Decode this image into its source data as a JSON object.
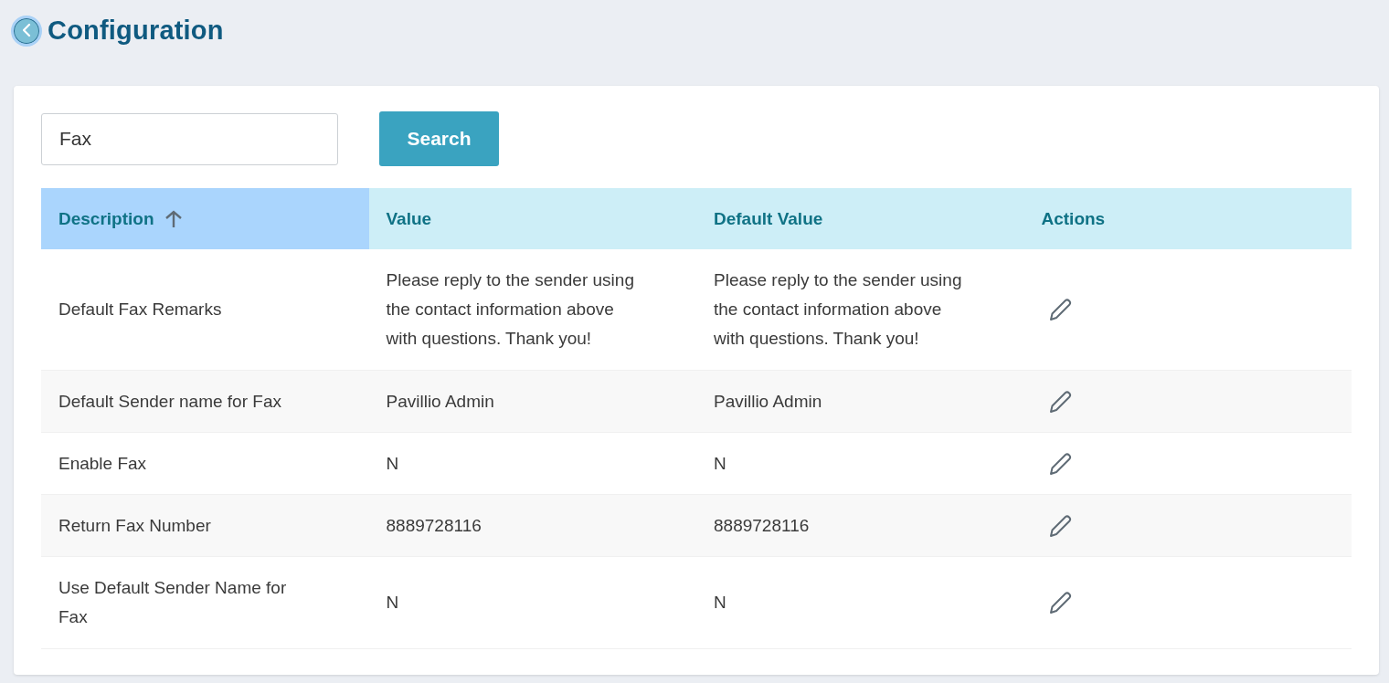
{
  "page": {
    "title": "Configuration"
  },
  "search": {
    "value": "Fax",
    "button": "Search"
  },
  "table": {
    "columns": [
      {
        "label": "Description",
        "sorted": true
      },
      {
        "label": "Value",
        "sorted": false
      },
      {
        "label": "Default Value",
        "sorted": false
      },
      {
        "label": "Actions",
        "sorted": false
      }
    ],
    "rows": [
      {
        "description": "Default Fax Remarks",
        "value": "Please reply to the sender using the contact information above with questions. Thank you!",
        "default_value": "Please reply to the sender using the contact information above with questions. Thank you!"
      },
      {
        "description": "Default Sender name for Fax",
        "value": "Pavillio Admin",
        "default_value": "Pavillio Admin"
      },
      {
        "description": "Enable Fax",
        "value": "N",
        "default_value": "N"
      },
      {
        "description": "Return Fax Number",
        "value": "8889728116",
        "default_value": "8889728116"
      },
      {
        "description": "Use Default Sender Name for Fax",
        "value": "N",
        "default_value": "N"
      }
    ]
  }
}
